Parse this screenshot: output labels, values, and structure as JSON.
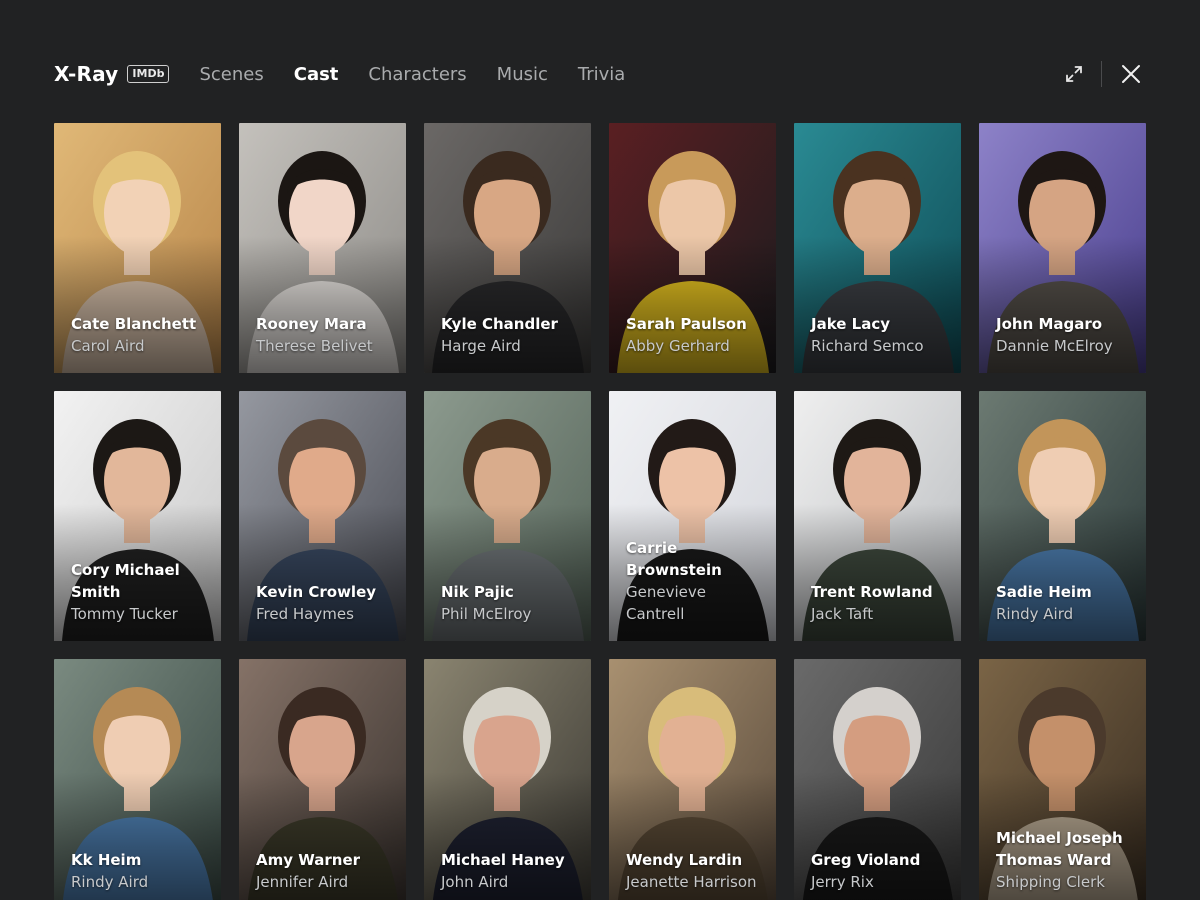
{
  "header": {
    "title": "X-Ray",
    "badge": "IMDb",
    "tabs": [
      {
        "label": "Scenes",
        "active": false
      },
      {
        "label": "Cast",
        "active": true
      },
      {
        "label": "Characters",
        "active": false
      },
      {
        "label": "Music",
        "active": false
      },
      {
        "label": "Trivia",
        "active": false
      }
    ],
    "icons": {
      "expand": "expand-icon",
      "close": "close-icon"
    }
  },
  "cast": [
    {
      "actor": "Cate Blanchett",
      "role": "Carol Aird",
      "bg": "#b8864a",
      "bg2": "#e0b877",
      "skin": "#f2d2b6",
      "hair": "#e3c27a",
      "cloth": "#d9c2ac"
    },
    {
      "actor": "Rooney Mara",
      "role": "Therese Belivet",
      "bg": "#8e8c88",
      "bg2": "#c4c1bc",
      "skin": "#f1d6c8",
      "hair": "#1b1613",
      "cloth": "#e8e4e0"
    },
    {
      "actor": "Kyle Chandler",
      "role": "Harge Aird",
      "bg": "#3c3b3a",
      "bg2": "#6b6866",
      "skin": "#d8a784",
      "hair": "#3a2a1f",
      "cloth": "#2a2a2c"
    },
    {
      "actor": "Sarah Paulson",
      "role": "Abby Gerhard",
      "bg": "#1c1c1f",
      "bg2": "#5a1f22",
      "skin": "#ecc7a8",
      "hair": "#c89a5a",
      "cloth": "#e3c020"
    },
    {
      "actor": "Jake Lacy",
      "role": "Richard Semco",
      "bg": "#0f4d57",
      "bg2": "#2a8a93",
      "skin": "#dcae8c",
      "hair": "#4a3220",
      "cloth": "#3c3f44"
    },
    {
      "actor": "John Magaro",
      "role": "Dannie McElroy",
      "bg": "#4a3f8e",
      "bg2": "#8d82c8",
      "skin": "#d5a483",
      "hair": "#1e1714",
      "cloth": "#55504a"
    },
    {
      "actor": "Cory Michael Smith",
      "role": "Tommy Tucker",
      "bg": "#c9c9c9",
      "bg2": "#f2f2f2",
      "skin": "#e2b79a",
      "hair": "#1c1815",
      "cloth": "#222"
    },
    {
      "actor": "Kevin Crowley",
      "role": "Fred Haymes",
      "bg": "#4b4d55",
      "bg2": "#9598a0",
      "skin": "#e0aa8a",
      "hair": "#5b4a3e",
      "cloth": "#3a4a63"
    },
    {
      "actor": "Nik Pajic",
      "role": "Phil McElroy",
      "bg": "#556459",
      "bg2": "#8c9a8e",
      "skin": "#d9ac8c",
      "hair": "#4b3826",
      "cloth": "#6f7578"
    },
    {
      "actor": "Carrie Brownstein",
      "role": "Genevieve Cantrell",
      "bg": "#d4d6dc",
      "bg2": "#f0f1f4",
      "skin": "#edc2a7",
      "hair": "#221a17",
      "cloth": "#1a1a1a"
    },
    {
      "actor": "Trent Rowland",
      "role": "Jack Taft",
      "bg": "#b9bcbf",
      "bg2": "#efefef",
      "skin": "#e2b49a",
      "hair": "#1e1915",
      "cloth": "#3f4a3e"
    },
    {
      "actor": "Sadie Heim",
      "role": "Rindy Aird",
      "bg": "#2c3a3a",
      "bg2": "#6c7a72",
      "skin": "#efcdb3",
      "hair": "#c2955a",
      "cloth": "#4d7eb0"
    },
    {
      "actor": "Kk Heim",
      "role": "Rindy Aird",
      "bg": "#3a4a45",
      "bg2": "#7a8a80",
      "skin": "#efcdb3",
      "hair": "#b58a55",
      "cloth": "#4d7eb0"
    },
    {
      "actor": "Amy Warner",
      "role": "Jennifer Aird",
      "bg": "#3b3430",
      "bg2": "#857267",
      "skin": "#d8a58c",
      "hair": "#3a2a22",
      "cloth": "#3d3b2a"
    },
    {
      "actor": "Michael Haney",
      "role": "John Aird",
      "bg": "#3c3a34",
      "bg2": "#8a8470",
      "skin": "#d9a48d",
      "hair": "#d6d2c8",
      "cloth": "#1f2232"
    },
    {
      "actor": "Wendy Lardin",
      "role": "Jeanette Harrison",
      "bg": "#5a4b3c",
      "bg2": "#a89070",
      "skin": "#e2b193",
      "hair": "#d8bc7a",
      "cloth": "#5a4a36"
    },
    {
      "actor": "Greg Violand",
      "role": "Jerry Rix",
      "bg": "#3a3a3a",
      "bg2": "#6a6a6a",
      "skin": "#d49d80",
      "hair": "#d4d0cc",
      "cloth": "#1a1a1a"
    },
    {
      "actor": "Michael Joseph Thomas Ward",
      "role": "Shipping Clerk",
      "bg": "#3b2f22",
      "bg2": "#7a6446",
      "skin": "#c4906a",
      "hair": "#4b3a2c",
      "cloth": "#b5a690"
    }
  ]
}
